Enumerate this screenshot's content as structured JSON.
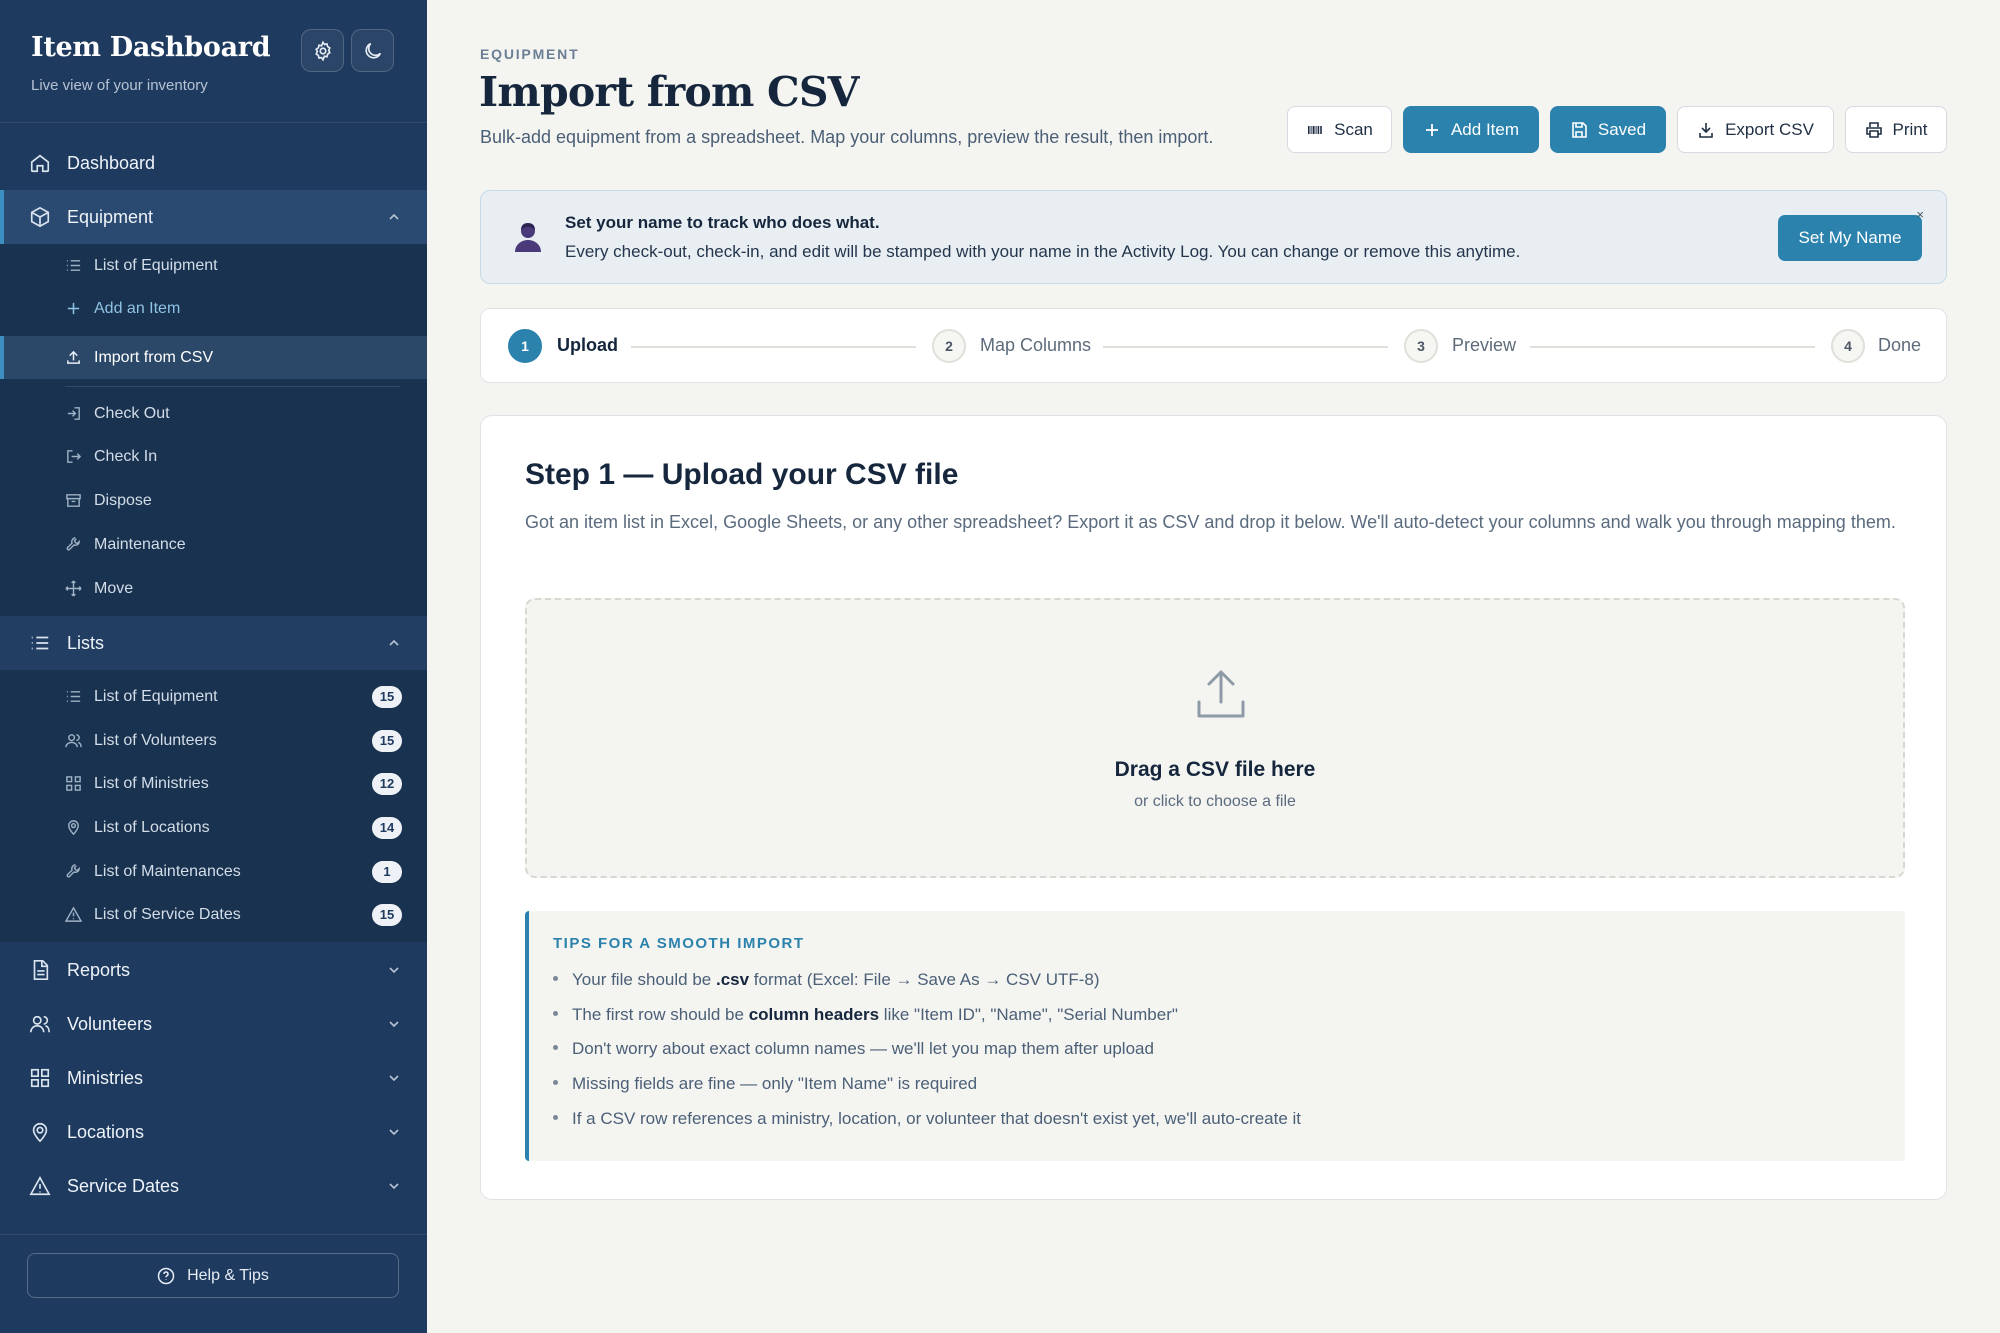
{
  "sidebar": {
    "brand_title": "Item Dashboard",
    "brand_subtitle": "Live view of your inventory",
    "nav": {
      "dashboard": "Dashboard",
      "equipment": "Equipment",
      "lists": "Lists",
      "reports": "Reports",
      "volunteers": "Volunteers",
      "ministries": "Ministries",
      "locations": "Locations",
      "service_dates": "Service Dates"
    },
    "equipment_items": [
      {
        "label": "List of Equipment"
      },
      {
        "label": "Add an Item"
      },
      {
        "label": "Import from CSV"
      },
      {
        "label": "Check Out"
      },
      {
        "label": "Check In"
      },
      {
        "label": "Dispose"
      },
      {
        "label": "Maintenance"
      },
      {
        "label": "Move"
      }
    ],
    "list_items": [
      {
        "label": "List of Equipment",
        "count": "15"
      },
      {
        "label": "List of Volunteers",
        "count": "15"
      },
      {
        "label": "List of Ministries",
        "count": "12"
      },
      {
        "label": "List of Locations",
        "count": "14"
      },
      {
        "label": "List of Maintenances",
        "count": "1"
      },
      {
        "label": "List of Service Dates",
        "count": "15"
      }
    ],
    "help_label": "Help & Tips"
  },
  "header": {
    "eyebrow": "EQUIPMENT",
    "title": "Import from CSV",
    "subtitle": "Bulk-add equipment from a spreadsheet. Map your columns, preview the result, then import."
  },
  "toolbar": {
    "scan": "Scan",
    "add_item": "Add Item",
    "saved": "Saved",
    "export_csv": "Export CSV",
    "print": "Print"
  },
  "banner": {
    "title": "Set your name to track who does what.",
    "text": "Every check-out, check-in, and edit will be stamped with your name in the Activity Log. You can change or remove this anytime.",
    "button": "Set My Name",
    "close": "×"
  },
  "stepper": [
    {
      "num": "1",
      "label": "Upload"
    },
    {
      "num": "2",
      "label": "Map Columns"
    },
    {
      "num": "3",
      "label": "Preview"
    },
    {
      "num": "4",
      "label": "Done"
    }
  ],
  "card": {
    "title": "Step 1 — Upload your CSV file",
    "description": "Got an item list in Excel, Google Sheets, or any other spreadsheet? Export it as CSV and drop it below. We'll auto-detect your columns and walk you through mapping them.",
    "drop_title": "Drag a CSV file here",
    "drop_sub": "or click to choose a file"
  },
  "tips": {
    "title": "TIPS FOR A SMOOTH IMPORT",
    "t1_pre": "Your file should be ",
    "t1_bold": ".csv",
    "t1_post": " format (Excel: File → Save As → CSV UTF-8)",
    "t2_pre": "The first row should be ",
    "t2_bold": "column headers",
    "t2_post": " like \"Item ID\", \"Name\", \"Serial Number\"",
    "t3": "Don't worry about exact column names — we'll let you map them after upload",
    "t4": "Missing fields are fine — only \"Item Name\" is required",
    "t5": "If a CSV row references a ministry, location, or volunteer that doesn't exist yet, we'll auto-create it"
  },
  "colors": {
    "sidebar": "#1e3a5f",
    "accent": "#2b82ad",
    "background": "#f4f4f1"
  }
}
